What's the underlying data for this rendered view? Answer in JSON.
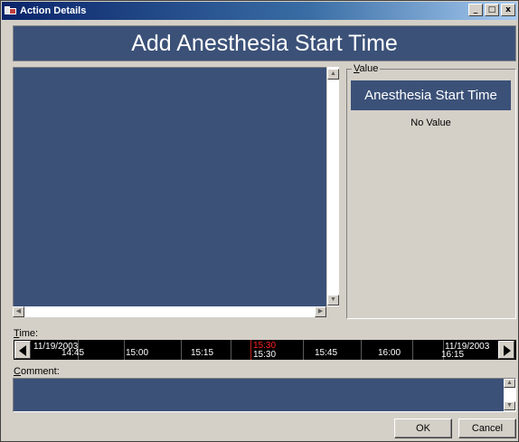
{
  "window": {
    "title": "Action Details",
    "controls": [
      "_",
      "□",
      "x"
    ]
  },
  "banner": {
    "title": "Add Anesthesia Start Time"
  },
  "value_panel": {
    "legend_mnemonic": "V",
    "legend_rest": "alue",
    "heading": "Anesthesia Start Time",
    "value": "No Value"
  },
  "time": {
    "label_mnemonic": "T",
    "label_rest": "ime:",
    "start_date": "11/19/2003",
    "end_date": "11/19/2003",
    "ticks": [
      "14:45",
      "15:00",
      "15:15",
      "15:30",
      "15:45",
      "16:00",
      "16:15"
    ],
    "cursor_top": "15:30",
    "cursor_bottom": "15:30"
  },
  "comment": {
    "label_mnemonic": "C",
    "label_rest": "omment:",
    "value": ""
  },
  "buttons": {
    "ok": "OK",
    "cancel": "Cancel"
  },
  "colors": {
    "panel_blue": "#3b5178",
    "window_gray": "#d4d0c8",
    "cursor_red": "#ff2020"
  }
}
